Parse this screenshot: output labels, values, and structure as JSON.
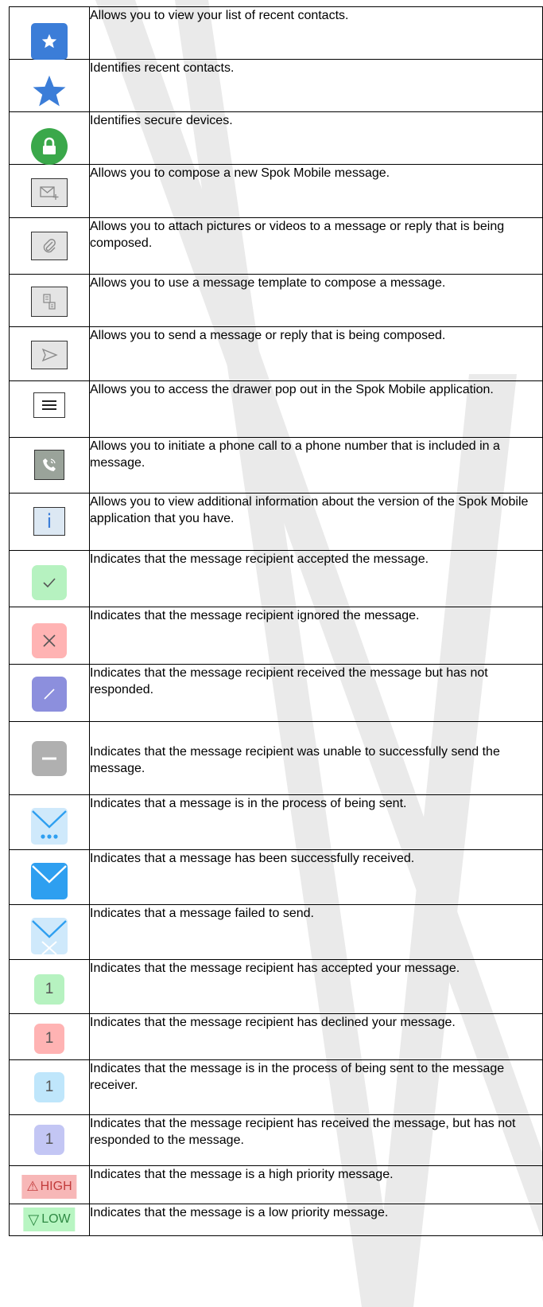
{
  "rows": [
    {
      "icon": "recent-contacts-star-button-icon",
      "text": "Allows you to view your list of recent contacts."
    },
    {
      "icon": "star-icon",
      "text": "Identifies recent contacts."
    },
    {
      "icon": "lock-icon",
      "text": "Identifies secure devices."
    },
    {
      "icon": "compose-message-icon",
      "text": "Allows you to compose a new Spok Mobile message."
    },
    {
      "icon": "paperclip-icon",
      "text": "Allows you to attach pictures or videos to a message or reply that is being composed."
    },
    {
      "icon": "template-icon",
      "text": "Allows you to use a message template to compose a message."
    },
    {
      "icon": "send-icon",
      "text": "Allows you to send a message or reply that is being composed."
    },
    {
      "icon": "menu-drawer-icon",
      "text": "Allows you to access the drawer pop out in the Spok Mobile application."
    },
    {
      "icon": "phone-call-icon",
      "text": "Allows you to initiate a phone call to a phone number that is included in a message."
    },
    {
      "icon": "info-icon",
      "text": "Allows you to view additional information about the version of the Spok Mobile application that you have."
    },
    {
      "icon": "accepted-check-icon",
      "text": "Indicates that the message recipient accepted the message."
    },
    {
      "icon": "ignored-x-icon",
      "text": "Indicates that the message recipient ignored the message."
    },
    {
      "icon": "received-slash-icon",
      "text": "Indicates that the message recipient received the message but has not responded."
    },
    {
      "icon": "failed-minus-icon",
      "text": "Indicates that the message recipient was unable to successfully send the message."
    },
    {
      "icon": "envelope-sending-icon",
      "text": "Indicates that a message is in the process of being sent."
    },
    {
      "icon": "envelope-received-icon",
      "text": "Indicates that a message has been successfully received."
    },
    {
      "icon": "envelope-failed-icon",
      "text": "Indicates that a message failed to send."
    },
    {
      "icon": "count-accepted-icon",
      "text": "Indicates that the message recipient has accepted your message.",
      "count": "1"
    },
    {
      "icon": "count-declined-icon",
      "text": "Indicates that the message recipient has declined your message.",
      "count": "1"
    },
    {
      "icon": "count-sending-icon",
      "text": "Indicates that the message is in the process of being sent to the message receiver.",
      "count": "1"
    },
    {
      "icon": "count-received-icon",
      "text": "Indicates that the message recipient has received the message, but has not responded to the message.",
      "count": "1"
    },
    {
      "icon": "high-priority-icon",
      "text": "Indicates that the message is a high priority message.",
      "label": "HIGH"
    },
    {
      "icon": "low-priority-icon",
      "text": "Indicates that the message is a low priority message.",
      "label": "LOW"
    }
  ],
  "colors": {
    "blue": "#3b7dd8",
    "green": "#3aa84a",
    "accepted": "#b6f2c0",
    "ignored": "#ffb3b3",
    "received": "#8c8fdd",
    "failed": "#b0b0b0",
    "envelope_light": "#cfe9fb",
    "envelope": "#2e9ff0",
    "high_bg": "#f7b7b7",
    "low_bg": "#b8f5c2"
  }
}
